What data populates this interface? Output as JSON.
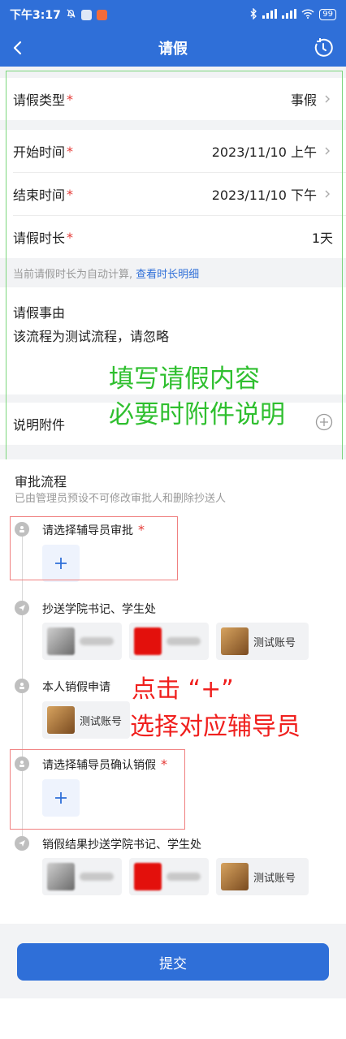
{
  "status_bar": {
    "time": "下午3:17",
    "battery": "99"
  },
  "nav": {
    "title": "请假"
  },
  "form": {
    "leave_type": {
      "label": "请假类型",
      "required": "*",
      "value": "事假"
    },
    "start_time": {
      "label": "开始时间",
      "required": "*",
      "value": "2023/11/10 上午"
    },
    "end_time": {
      "label": "结束时间",
      "required": "*",
      "value": "2023/11/10 下午"
    },
    "duration": {
      "label": "请假时长",
      "required": "*",
      "value": "1天"
    },
    "hint_text": "当前请假时长为自动计算,",
    "hint_link": "查看时长明细",
    "reason_label": "请假事由",
    "reason_value": "该流程为测试流程，请忽略",
    "attachment_label": "说明附件"
  },
  "annotations": {
    "green_line1": "填写请假内容",
    "green_line2": "必要时附件说明",
    "red_line1": "点击 “+”",
    "red_line2": "选择对应辅导员"
  },
  "flow": {
    "title": "审批流程",
    "subtitle": "已由管理员预设不可修改审批人和删除抄送人",
    "steps": [
      {
        "title": "请选择辅导员审批",
        "required": "*"
      },
      {
        "title": "抄送学院书记、学生处",
        "chips": [
          "",
          "",
          "测试账号"
        ]
      },
      {
        "title": "本人销假申请",
        "chips": [
          "测试账号"
        ]
      },
      {
        "title": "请选择辅导员确认销假",
        "required": "*"
      },
      {
        "title": "销假结果抄送学院书记、学生处",
        "chips": [
          "",
          "",
          "测试账号"
        ]
      }
    ]
  },
  "submit_label": "提交",
  "colors": {
    "primary": "#2f6fd8",
    "required": "#e53935",
    "annotation_green": "#2fbf2f",
    "annotation_red": "#f0201e"
  }
}
